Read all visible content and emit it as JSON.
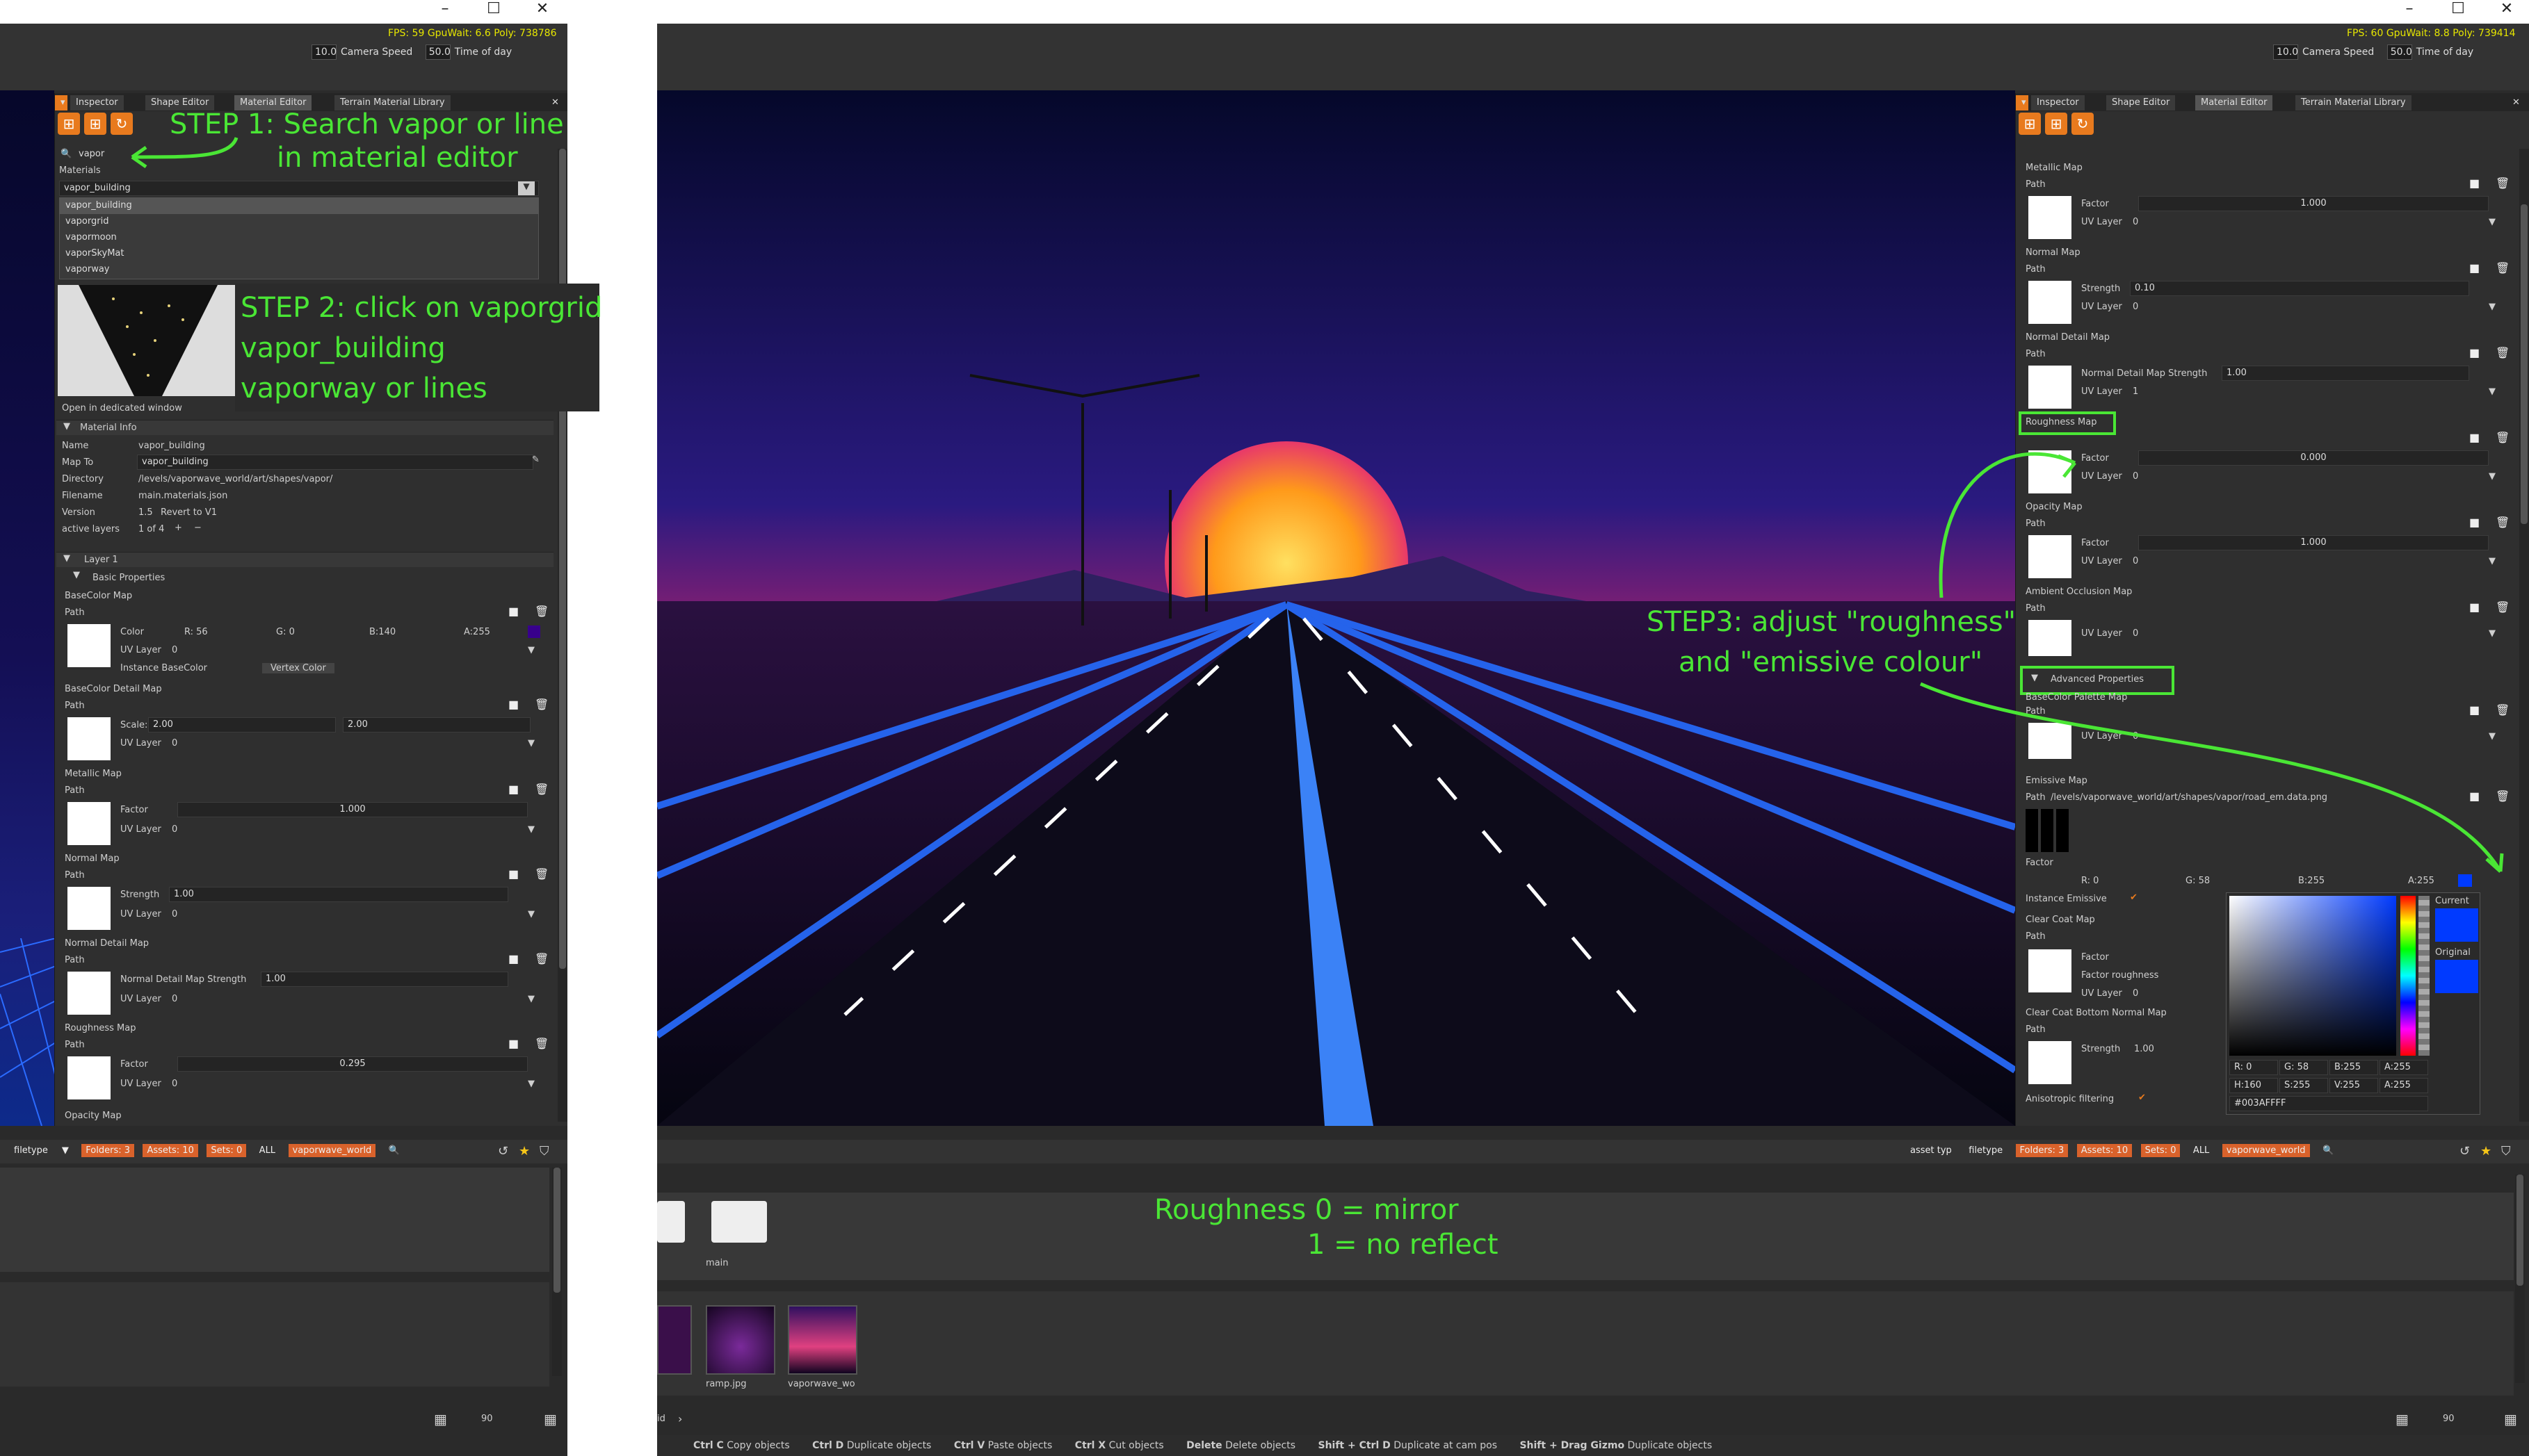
{
  "left_window": {
    "fps": "FPS: 59 GpuWait: 6.6 Poly: 738786",
    "camera_speed_value": "10.0",
    "camera_speed_label": "Camera Speed",
    "time_value": "50.0",
    "time_label": "Time of day",
    "tabs": [
      "Inspector",
      "Shape Editor",
      "Material Editor",
      "Terrain Material Library"
    ],
    "search_value": "vapor",
    "materials_label": "Materials",
    "selected_material": "vapor_building",
    "material_list": [
      "vapor_building",
      "vaporgrid",
      "vapormoon",
      "vaporSkyMat",
      "vaporway"
    ],
    "open_dedicated": "Open in dedicated window",
    "material_info": "Material Info",
    "info": [
      {
        "k": "Name",
        "v": "vapor_building"
      },
      {
        "k": "Map To",
        "v": "vapor_building"
      },
      {
        "k": "Directory",
        "v": "/levels/vaporwave_world/art/shapes/vapor/"
      },
      {
        "k": "Filename",
        "v": "main.materials.json"
      },
      {
        "k": "Version",
        "v": "1.5"
      },
      {
        "k": "active layers",
        "v": "1 of 4"
      }
    ],
    "revert": "Revert to V1",
    "layer1": "Layer 1",
    "basic_props": "Basic Properties",
    "basecolor_map": "BaseColor Map",
    "path": "Path",
    "color": "Color",
    "color_r": "R: 56",
    "color_g": "G: 0",
    "color_b": "B:140",
    "color_a": "A:255",
    "uv_layer": "UV Layer",
    "uv0": "0",
    "uv1": "1",
    "instance_basecolor": "Instance BaseColor",
    "vertex_color": "Vertex Color",
    "basecolor_detail": "BaseColor Detail Map",
    "scale": "Scale:",
    "scale1": "2.00",
    "scale2": "2.00",
    "metallic_map": "Metallic Map",
    "factor": "Factor",
    "metallic_factor": "1.000",
    "normal_map": "Normal Map",
    "strength": "Strength",
    "normal_strength": "1.00",
    "normal_detail": "Normal Detail Map",
    "normal_detail_strength_label": "Normal Detail Map Strength",
    "normal_detail_strength": "1.00",
    "roughness_map": "Roughness Map",
    "roughness_factor": "0.295",
    "opacity_map": "Opacity Map",
    "bottom": {
      "filetype": "filetype",
      "folders": "Folders: 3",
      "assets": "Assets: 10",
      "sets": "Sets: 0",
      "all": "ALL",
      "world": "vaporwave_world",
      "zoom": "90"
    }
  },
  "annotations": {
    "step1_a": "STEP 1: Search vapor or line",
    "step1_b": "in material editor",
    "step2_a": "STEP 2: click on vaporgrid",
    "step2_b": "vapor_building",
    "step2_c": "vaporway or lines",
    "step3_a": "STEP3: adjust \"roughness\"",
    "step3_b": "and \"emissive colour\"",
    "rough_a": "Roughness 0 = mirror",
    "rough_b": "1 = no reflect"
  },
  "right_window": {
    "fps": "FPS: 60 GpuWait: 8.8 Poly: 739414",
    "camera_speed_value": "10.0",
    "camera_speed_label": "Camera Speed",
    "time_value": "50.0",
    "time_label": "Time of day",
    "tabs": [
      "Inspector",
      "Shape Editor",
      "Material Editor",
      "Terrain Material Library"
    ],
    "metallic_map": "Metallic Map",
    "path": "Path",
    "factor": "Factor",
    "metallic_factor": "1.000",
    "uv_layer": "UV Layer",
    "uv0": "0",
    "uv1": "1",
    "normal_map": "Normal Map",
    "strength": "Strength",
    "normal_strength": "0.10",
    "normal_detail": "Normal Detail Map",
    "normal_detail_strength_label": "Normal Detail Map Strength",
    "normal_detail_strength": "1.00",
    "roughness_map": "Roughness Map",
    "roughness_factor": "0.000",
    "opacity_map": "Opacity Map",
    "opacity_factor": "1.000",
    "ao_map": "Ambient Occlusion Map",
    "advanced": "Advanced Properties",
    "basecolor_palette": "BaseColor Palette Map",
    "emissive_map": "Emissive Map",
    "emissive_path": "/levels/vaporwave_world/art/shapes/vapor/road_em.data.png",
    "factor_label": "Factor",
    "em_r": "R: 0",
    "em_g": "G: 58",
    "em_b": "B:255",
    "em_a": "A:255",
    "instance_emissive": "Instance Emissive",
    "clear_coat": "Clear Coat Map",
    "factor_roughness": "Factor roughness",
    "clear_coat_bottom": "Clear Coat Bottom Normal Map",
    "cc_strength": "1.00",
    "aniso": "Anisotropic filtering",
    "picker": {
      "current": "Current",
      "original": "Original",
      "r": "R: 0",
      "g": "G: 58",
      "b": "B:255",
      "a": "A:255",
      "h": "H:160",
      "s": "S:255",
      "v": "V:255",
      "a2": "A:255",
      "hex": "#003AFFFF",
      "color": "#003aff"
    },
    "bottom": {
      "asset_type": "asset typ",
      "filetype": "filetype",
      "folders": "Folders: 3",
      "assets": "Assets: 10",
      "sets": "Sets: 0",
      "all": "ALL",
      "world": "vaporwave_world",
      "zoom": "90",
      "folder": "main",
      "thumbs": [
        "ramp.jpg",
        "vaporwave_wo"
      ],
      "id": "id"
    },
    "status": [
      {
        "k": "Ctrl C",
        "v": "Copy objects"
      },
      {
        "k": "Ctrl D",
        "v": "Duplicate objects"
      },
      {
        "k": "Ctrl V",
        "v": "Paste objects"
      },
      {
        "k": "Ctrl X",
        "v": "Cut objects"
      },
      {
        "k": "Delete",
        "v": "Delete objects"
      },
      {
        "k": "Shift + Ctrl D",
        "v": "Duplicate at cam pos"
      },
      {
        "k": "Shift + Drag Gizmo",
        "v": "Duplicate objects"
      }
    ]
  },
  "colors": {
    "accent": "#e87a1e",
    "annotation": "#4ae635",
    "chip": "#d9622b"
  }
}
